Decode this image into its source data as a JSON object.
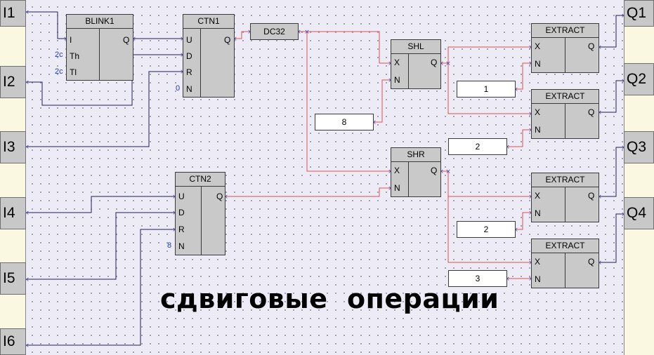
{
  "inputs": [
    "I1",
    "I2",
    "I3",
    "I4",
    "I5",
    "I6"
  ],
  "outputs": [
    "Q1",
    "Q2",
    "Q3",
    "Q4"
  ],
  "blink1": {
    "title": "BLINK1",
    "pins": [
      "I",
      "Th",
      "Tl"
    ],
    "out": "Q",
    "params": [
      "2c",
      "2c"
    ]
  },
  "ctn1": {
    "title": "CTN1",
    "pins": [
      "U",
      "D",
      "R",
      "N"
    ],
    "out": "Q",
    "param_n": "0"
  },
  "ctn2": {
    "title": "CTN2",
    "pins": [
      "U",
      "D",
      "R",
      "N"
    ],
    "out": "Q",
    "param_n": "8"
  },
  "dc32": {
    "title": "DC32"
  },
  "shl": {
    "title": "SHL",
    "pins": [
      "X",
      "N"
    ],
    "out": "Q"
  },
  "shr": {
    "title": "SHR",
    "pins": [
      "X",
      "N"
    ],
    "out": "Q"
  },
  "extract": {
    "title": "EXTRACT",
    "pins": [
      "X",
      "N"
    ],
    "out": "Q"
  },
  "constants": {
    "shl_n": "8",
    "ex1_n": "1",
    "ex2_n": "2",
    "ex3_n": "2",
    "ex4_n": "3"
  },
  "caption": "сдвиговые  операции",
  "colors": {
    "wire_logic": "#1f1f5a",
    "wire_signal": "#e05050",
    "background": "#ecebf6",
    "rail": "#faf8e0",
    "block": "#c9c9c9"
  }
}
